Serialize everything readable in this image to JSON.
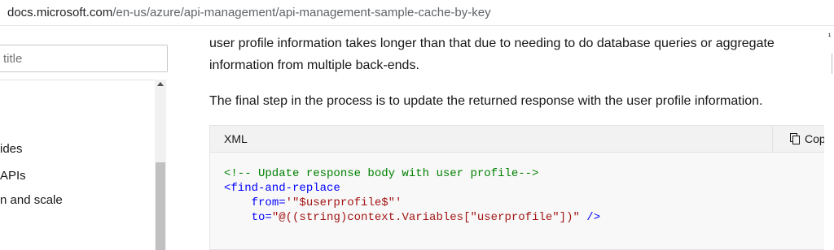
{
  "browser": {
    "url_host": "docs.microsoft.com",
    "url_path": "/en-us/azure/api-management/api-management-sample-cache-by-key"
  },
  "sidebar": {
    "filter_placeholder": "title",
    "items": [
      {
        "label": "ides"
      },
      {
        "label": "APIs"
      },
      {
        "label": "n and scale"
      }
    ]
  },
  "article": {
    "paragraph_1": "user profile information takes longer than that due to needing to do database queries or aggregate information from multiple back-ends.",
    "paragraph_2": "The final step in the process is to update the returned response with the user profile information.",
    "code": {
      "language": "XML",
      "copy_label": "Copy",
      "line_1_comment": "<!-- Update response body with user profile-->",
      "line_2_tag": "<find-and-replace",
      "line_3_attr": "from=",
      "line_3_value": "'\"$userprofile$\"'",
      "line_4_attr": "to=",
      "line_4_value": "\"@((string)context.Variables[\"userprofile\"])\"",
      "line_4_close": " />"
    }
  },
  "right_marker": "¹"
}
